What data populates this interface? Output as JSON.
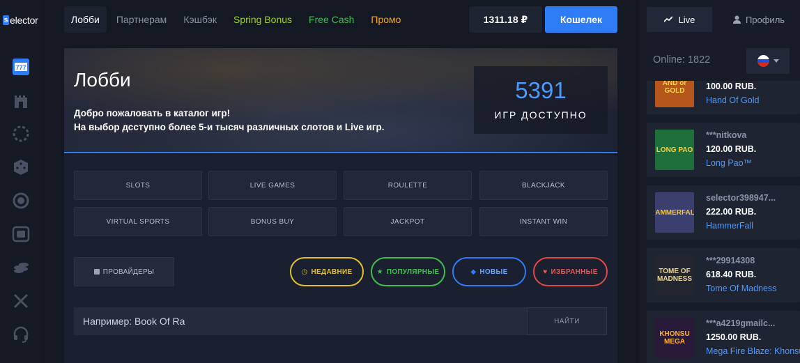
{
  "logo": {
    "mark": "s",
    "text": "elector"
  },
  "rail": {
    "icons": [
      {
        "name": "slots-777-icon",
        "active": true
      },
      {
        "name": "castle-icon",
        "active": false
      },
      {
        "name": "dashed-circle-icon",
        "active": false
      },
      {
        "name": "dice-icon",
        "active": false
      },
      {
        "name": "target-icon",
        "active": false
      },
      {
        "name": "tv-icon",
        "active": false
      },
      {
        "name": "coins-icon",
        "active": false
      },
      {
        "name": "crossed-swords-icon",
        "active": false
      },
      {
        "name": "headset-icon",
        "active": false
      }
    ]
  },
  "nav": {
    "items": [
      {
        "label": "Лобби",
        "color": "#ffffff",
        "active": true
      },
      {
        "label": "Партнерам",
        "color": "#8a93a6"
      },
      {
        "label": "Кэшбэк",
        "color": "#8a93a6"
      },
      {
        "label": "Spring Bonus",
        "color": "#9fd421"
      },
      {
        "label": "Free Cash",
        "color": "#3fbf4f"
      },
      {
        "label": "Промо",
        "color": "#f5a623"
      }
    ],
    "balance": "1311.18 ₽",
    "wallet_label": "Кошелек"
  },
  "hero": {
    "title": "Лобби",
    "desc_line1": "Добро пожаловать в каталог игр!",
    "desc_line2": "На выбор дсступно более 5-и тысяч различных слотов и Live игр.",
    "count": "5391",
    "count_label": "ИГР ДОСТУПНО"
  },
  "categories": [
    "SLOTS",
    "LIVE GAMES",
    "ROULETTE",
    "BLACKJACK",
    "VIRTUAL SPORTS",
    "BONUS BUY",
    "JACKPOT",
    "INSTANT WIN"
  ],
  "providers_label": "ПРОВАЙДЕРЫ",
  "filters": [
    {
      "label": "НЕДАВНИЕ",
      "icon": "clock-icon",
      "glyph": "◷",
      "color": "#e3c02a"
    },
    {
      "label": "ПОПУЛЯРНЫЕ",
      "icon": "star-icon",
      "glyph": "★",
      "color": "#3fbf4f"
    },
    {
      "label": "НОВЫЕ",
      "icon": "diamond-icon",
      "glyph": "◆",
      "color": "#2e7cf6"
    },
    {
      "label": "ИЗБРАННЫЕ",
      "icon": "heart-icon",
      "glyph": "♥",
      "color": "#e04848"
    }
  ],
  "search": {
    "placeholder": "Например: Book Of Ra",
    "button": "НАЙТИ"
  },
  "sidebar": {
    "live_label": "Live",
    "profile_label": "Профиль",
    "online": "Online: 1822",
    "flag_colors": [
      "#ffffff",
      "#1f4fd6",
      "#d52b1e"
    ]
  },
  "feed": [
    {
      "user": "",
      "amount": "100.00 RUB.",
      "game": "Hand Of Gold",
      "thumb_text": "AND or GOLD",
      "thumb_bg": "#b5561c",
      "thumb_fg": "#ffd54a"
    },
    {
      "user": "***nitkova",
      "amount": "120.00 RUB.",
      "game": "Long Pao™",
      "thumb_text": "LONG PAO",
      "thumb_bg": "#1f6f3a",
      "thumb_fg": "#ffcf3a"
    },
    {
      "user": "selector398947...",
      "amount": "222.00 RUB.",
      "game": "HammerFall",
      "thumb_text": "HAMMERFALL",
      "thumb_bg": "#3b3f6e",
      "thumb_fg": "#f0c24a"
    },
    {
      "user": "***29914308",
      "amount": "618.40 RUB.",
      "game": "Tome Of Madness",
      "thumb_text": "TOME OF MADNESS",
      "thumb_bg": "#23262f",
      "thumb_fg": "#e8d49a"
    },
    {
      "user": "***a4219gmailc...",
      "amount": "1250.00 RUB.",
      "game": "Mega Fire Blaze: Khonsu",
      "thumb_text": "KHONSU MEGA",
      "thumb_bg": "#2a1a3a",
      "thumb_fg": "#ffb02e"
    }
  ]
}
